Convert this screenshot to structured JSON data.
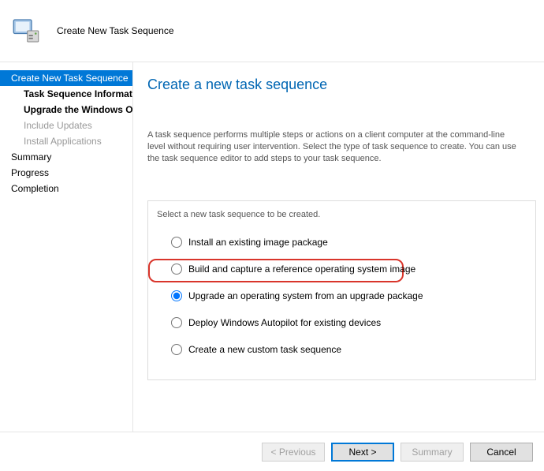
{
  "header": {
    "title": "Create New Task Sequence"
  },
  "sidebar": {
    "items": [
      {
        "label": "Create New Task Sequence",
        "selected": true,
        "level": 1
      },
      {
        "label": "Task Sequence Information",
        "level": 2
      },
      {
        "label": "Upgrade the Windows Operating System",
        "level": 2
      },
      {
        "label": "Include Updates",
        "level": 2,
        "disabled": true
      },
      {
        "label": "Install Applications",
        "level": 2,
        "disabled": true
      },
      {
        "label": "Summary",
        "level": 1
      },
      {
        "label": "Progress",
        "level": 1
      },
      {
        "label": "Completion",
        "level": 1
      }
    ]
  },
  "content": {
    "heading": "Create a new task sequence",
    "description": "A task sequence performs multiple steps or actions on a client computer at the command-line level without requiring user intervention. Select the type of task sequence to create. You can use the task sequence editor to add steps to your task sequence.",
    "group_label": "Select a new task sequence to be created.",
    "options": [
      {
        "id": "opt1",
        "label": "Install an existing image package",
        "selected": false
      },
      {
        "id": "opt2",
        "label": "Build and capture a reference operating system image",
        "selected": false
      },
      {
        "id": "opt3",
        "label": "Upgrade an operating system from an upgrade package",
        "selected": true
      },
      {
        "id": "opt4",
        "label": "Deploy Windows Autopilot for existing devices",
        "selected": false
      },
      {
        "id": "opt5",
        "label": "Create a new custom task sequence",
        "selected": false
      }
    ]
  },
  "footer": {
    "previous": "< Previous",
    "next": "Next >",
    "summary": "Summary",
    "cancel": "Cancel"
  }
}
